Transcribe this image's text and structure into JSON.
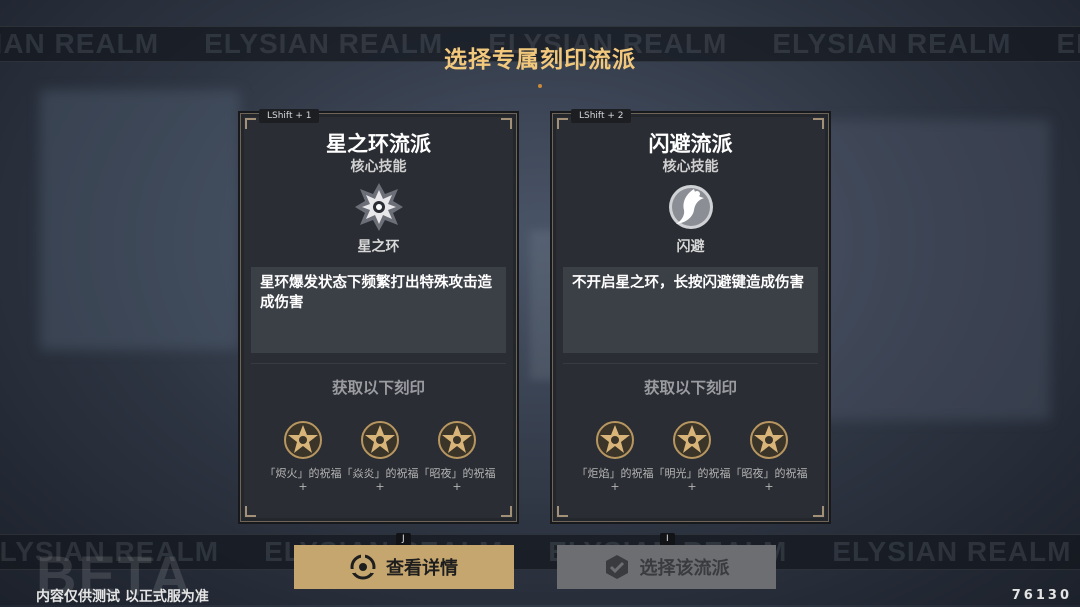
{
  "header": {
    "title": "选择专属刻印流派"
  },
  "watermark": {
    "text": "ELYSIAN REALM"
  },
  "cards": [
    {
      "hotkey": "LShift + 1",
      "title": "星之环流派",
      "subtitle": "核心技能",
      "skill_icon": "star-ring-emblem-icon",
      "skill_name": "星之环",
      "description": "星环爆发状态下频繁打出特殊攻击造成伤害",
      "rewards_title": "获取以下刻印",
      "rewards": [
        {
          "icon": "signet-emblem-icon",
          "label": "「烬火」的祝福+"
        },
        {
          "icon": "signet-emblem-icon",
          "label": "「焱炎」的祝福+"
        },
        {
          "icon": "signet-emblem-icon",
          "label": "「昭夜」的祝福+"
        }
      ]
    },
    {
      "hotkey": "LShift + 2",
      "title": "闪避流派",
      "subtitle": "核心技能",
      "skill_icon": "dodge-emblem-icon",
      "skill_name": "闪避",
      "description": "不开启星之环，长按闪避键造成伤害",
      "rewards_title": "获取以下刻印",
      "rewards": [
        {
          "icon": "signet-emblem-icon",
          "label": "「炬焰」的祝福+"
        },
        {
          "icon": "signet-emblem-icon",
          "label": "「明光」的祝福+"
        },
        {
          "icon": "signet-emblem-icon",
          "label": "「昭夜」的祝福+"
        }
      ]
    }
  ],
  "buttons": {
    "details": {
      "label": "查看详情",
      "key": "J",
      "icon": "view-details-icon"
    },
    "select": {
      "label": "选择该流派",
      "key": "I",
      "icon": "check-shield-icon"
    }
  },
  "footer": {
    "beta": "BETA",
    "note": "内容仅供测试 以正式服为准",
    "version": "76130"
  },
  "colors": {
    "title_gold": "#f2c87c",
    "card_bg": "#2a2d33",
    "details_button": "#c5a66f",
    "select_button_disabled": "#6c6e72"
  }
}
